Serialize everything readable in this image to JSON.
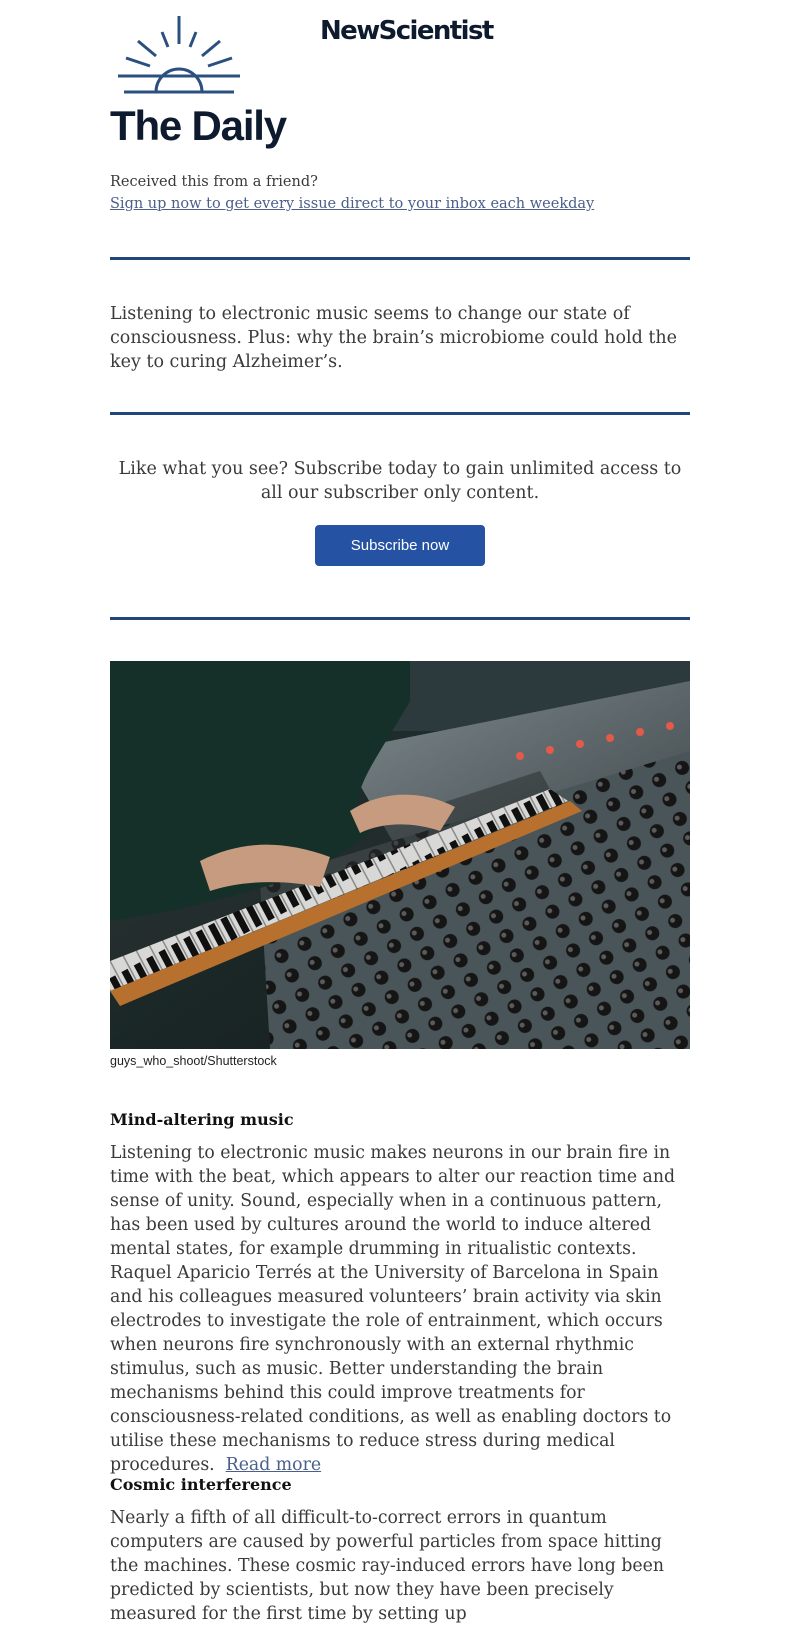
{
  "header": {
    "brand": "NewScientist",
    "title": "The Daily"
  },
  "signup": {
    "received_text": "Received this from a friend?",
    "link_text": "Sign up now to get every issue direct to your inbox each weekday"
  },
  "intro": {
    "text": "Listening to electronic music seems to change our state of consciousness. Plus: why the brain’s microbiome could hold the key to curing Alzheimer’s."
  },
  "promo": {
    "text": "Like what you see? Subscribe today to gain unlimited access to all our subscriber only content.",
    "button_label": "Subscribe now",
    "button_color": "#2552a3"
  },
  "hero_image": {
    "credit": "guys_who_shoot/Shutterstock"
  },
  "stories": [
    {
      "headline": "Mind-altering music",
      "body": "Listening to electronic music makes neurons in our brain fire in time with the beat, which appears to alter our reaction time and sense of unity. Sound, especially when in a continuous pattern, has been used by cultures around the world to induce altered mental states, for example drumming in ritualistic contexts. Raquel Aparicio Terrés at the University of Barcelona in Spain and his colleagues measured volunteers’ brain activity via skin electrodes to investigate the role of entrainment, which occurs when neurons fire synchronously with an external rhythmic stimulus, such as music. Better understanding the brain mechanisms behind this could improve treatments for consciousness-related conditions, as well as enabling doctors to utilise these mechanisms to reduce stress during medical procedures.",
      "read_more": "Read more"
    },
    {
      "headline": "Cosmic interference",
      "body": "Nearly a fifth of all difficult-to-correct errors in quantum computers are caused by powerful particles from space hitting the machines. These cosmic ray-induced errors have long been predicted by scientists, but now they have been precisely measured for the first time by setting up"
    }
  ],
  "colors": {
    "rule": "#21477a",
    "link": "#4a5f8a",
    "title": "#0e1a2e"
  }
}
